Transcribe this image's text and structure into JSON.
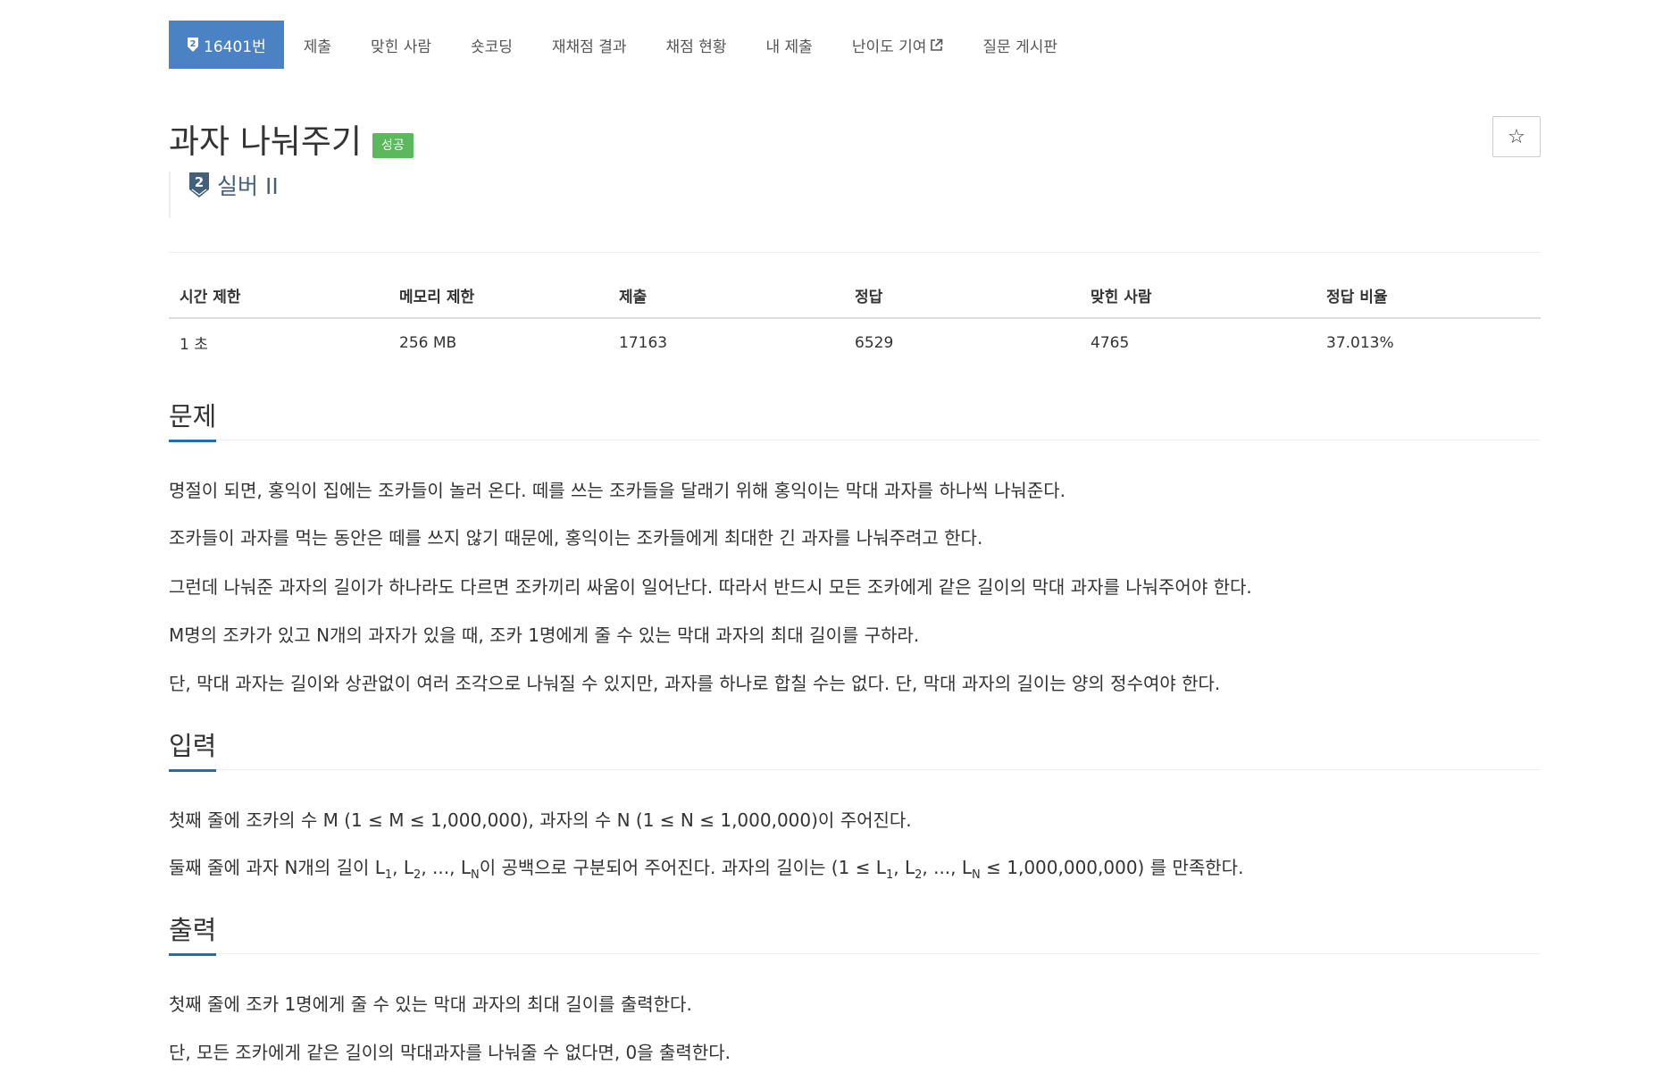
{
  "nav": {
    "problem_number": "16401번",
    "items": [
      "제출",
      "맞힌 사람",
      "숏코딩",
      "재채점 결과",
      "채점 현황",
      "내 제출",
      "난이도 기여",
      "질문 게시판"
    ]
  },
  "problem": {
    "title": "과자 나눠주기",
    "status_label": "성공",
    "tier": "실버 II",
    "tier_number": "2"
  },
  "stats": {
    "headers": [
      "시간 제한",
      "메모리 제한",
      "제출",
      "정답",
      "맞힌 사람",
      "정답 비율"
    ],
    "values": [
      "1 초",
      "256 MB",
      "17163",
      "6529",
      "4765",
      "37.013%"
    ]
  },
  "sections": {
    "description": {
      "title": "문제",
      "paragraphs": [
        "명절이 되면, 홍익이 집에는 조카들이 놀러 온다. 떼를 쓰는 조카들을 달래기 위해 홍익이는 막대 과자를 하나씩 나눠준다.",
        "조카들이 과자를 먹는 동안은 떼를 쓰지 않기 때문에, 홍익이는 조카들에게 최대한 긴 과자를 나눠주려고 한다.",
        "그런데 나눠준 과자의 길이가 하나라도 다르면 조카끼리 싸움이 일어난다. 따라서 반드시 모든 조카에게 같은 길이의 막대 과자를 나눠주어야 한다.",
        "M명의 조카가 있고 N개의 과자가 있을 때, 조카 1명에게 줄 수 있는 막대 과자의 최대 길이를 구하라.",
        "단, 막대 과자는 길이와 상관없이 여러 조각으로 나눠질 수 있지만, 과자를 하나로 합칠 수는 없다. 단, 막대 과자의 길이는 양의 정수여야 한다."
      ]
    },
    "input": {
      "title": "입력",
      "line1": "첫째 줄에 조카의 수 M (1 ≤ M ≤ 1,000,000), 과자의 수 N (1 ≤ N ≤ 1,000,000)이 주어진다.",
      "line2_parts": {
        "a": "둘째 줄에 과자 N개의 길이 L",
        "s1": "1",
        "b": ", L",
        "s2": "2",
        "c": ", ..., L",
        "sN": "N",
        "d": "이 공백으로 구분되어 주어진다. 과자의 길이는 (1 ≤ L",
        "e": ", L",
        "f": ", ..., L",
        "g": " ≤ 1,000,000,000) 를 만족한다."
      }
    },
    "output": {
      "title": "출력",
      "paragraphs": [
        "첫째 줄에 조카 1명에게 줄 수 있는 막대 과자의 최대 길이를 출력한다.",
        "단, 모든 조카에게 같은 길이의 막대과자를 나눠줄 수 없다면, 0을 출력한다."
      ]
    }
  },
  "colors": {
    "nav_active": "#4a82c4",
    "success": "#5cb85c",
    "tier_silver": "#435f7a",
    "section_underline": "#1e6eb4"
  }
}
